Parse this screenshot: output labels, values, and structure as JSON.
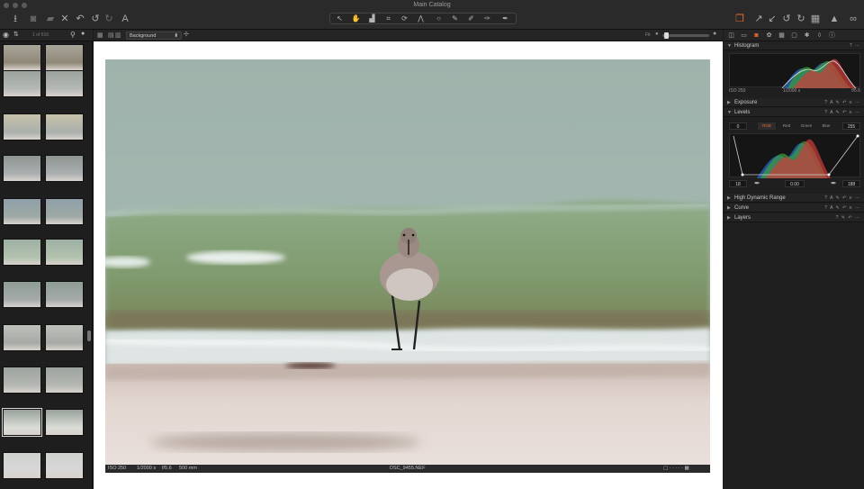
{
  "window": {
    "title": "Main Catalog"
  },
  "toolbar": {
    "left_icons": [
      "import-icon",
      "camera-icon",
      "export-icon",
      "delete-icon",
      "undo-all-icon",
      "undo-icon",
      "redo-icon",
      "text-icon"
    ],
    "center_tools": [
      "select-icon",
      "pan-icon",
      "loupe-icon",
      "crop-icon",
      "rotate-icon",
      "keystone-icon",
      "spot-icon",
      "brush-icon",
      "eraser-icon",
      "gradient-icon",
      "picker-icon"
    ],
    "right_icons": [
      "layers-icon",
      "grow-icon",
      "shrink-icon",
      "rotate-left-icon",
      "rotate-right-icon",
      "grid-icon",
      "warning-icon",
      "compare-icon"
    ]
  },
  "browser": {
    "counter": "1 of 616",
    "selected_index": 18
  },
  "viewer": {
    "layer_select": "Background",
    "fit_label": "Fit",
    "meta": {
      "iso": "ISO 250",
      "shutter": "1/2000 s",
      "aperture": "f/5.6",
      "focal": "500 mm",
      "filename": "DSC_9455.NEF"
    }
  },
  "tools": {
    "histogram": {
      "title": "Histogram",
      "iso": "ISO 250",
      "shutter": "1/2000 s",
      "aperture": "f/5.6"
    },
    "exposure": {
      "title": "Exposure"
    },
    "levels": {
      "title": "Levels",
      "input_low": "0",
      "input_high": "255",
      "channels": [
        "RGB",
        "Red",
        "Green",
        "Blue"
      ],
      "active_channel": "RGB",
      "output_low": "18",
      "midtone": "0.00",
      "output_high": "188"
    },
    "hdr": {
      "title": "High Dynamic Range"
    },
    "curve": {
      "title": "Curve"
    },
    "layers": {
      "title": "Layers"
    }
  },
  "colors": {
    "accent": "#e86a2c",
    "panel_bg": "#1f1f1f",
    "viewer_bg": "#ffffff"
  }
}
